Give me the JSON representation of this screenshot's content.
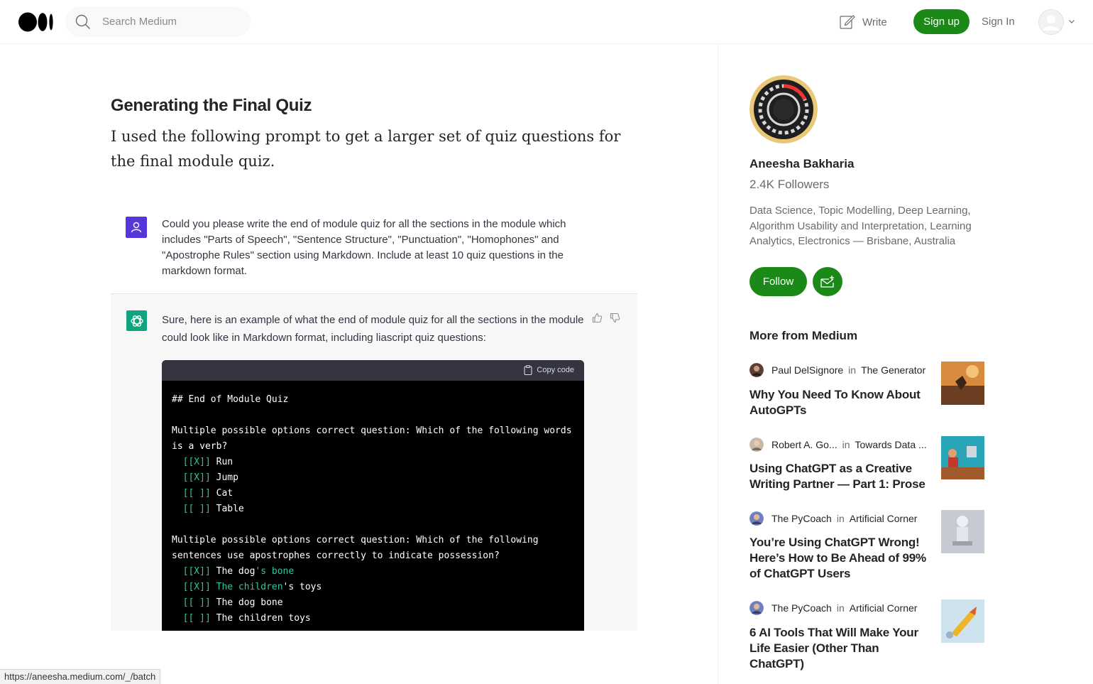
{
  "header": {
    "search_placeholder": "Search Medium",
    "write_label": "Write",
    "signup_label": "Sign up",
    "signin_label": "Sign In"
  },
  "article": {
    "heading": "Generating the Final Quiz",
    "paragraph": "I used the following prompt to get a larger set of quiz questions for the final module quiz."
  },
  "chat": {
    "user_prompt": "Could you please write the end of module quiz for all the sections in the module which includes \"Parts of Speech\",  \"Sentence Structure\",  \"Punctuation\", \"Homophones\" and \"Apostrophe Rules\" section using Markdown. Include at least 10 quiz questions in the markdown format.",
    "ai_reply": "Sure, here is an example of what the end of module quiz for all the sections in the module could look like in Markdown format, including liascript quiz questions:",
    "copy_label": "Copy code",
    "code_lines": {
      "l1": "## End of Module Quiz",
      "l2": "Multiple possible options correct question: Which of the following words",
      "l3": "is a verb?",
      "l4_box": "[[X]]",
      "l4_text": " Run",
      "l5_box": "[[X]]",
      "l5_text": " Jump",
      "l6_box": "[[ ]]",
      "l6_text": " Cat",
      "l7_box": "[[ ]]",
      "l7_text": " Table",
      "l8": "Multiple possible options correct question: Which of the following",
      "l9": "sentences use apostrophes correctly to indicate possession?",
      "l10_box": "[[X]]",
      "l10_a": " The dog",
      "l10_b": "'s bone",
      "l11_box": "[[X]]",
      "l11_a": " The children",
      "l11_b": "'s toys",
      "l12_box": "[[ ]]",
      "l12_text": " The dog bone",
      "l13_box": "[[ ]]",
      "l13_text": " The children toys"
    }
  },
  "author": {
    "name": "Aneesha Bakharia",
    "followers": "2.4K Followers",
    "bio": "Data Science, Topic Modelling, Deep Learning, Algorithm Usability and Interpretation, Learning Analytics, Electronics — Brisbane, Australia",
    "follow_label": "Follow"
  },
  "more_from_medium": {
    "heading": "More from Medium",
    "in_label": "in",
    "items": [
      {
        "author": "Paul DelSignore",
        "publication": "The Generator",
        "title": "Why You Need To Know About AutoGPTs"
      },
      {
        "author": "Robert A. Go...",
        "publication": "Towards Data ...",
        "title": "Using ChatGPT as a Creative Writing Partner — Part 1: Prose"
      },
      {
        "author": "The PyCoach",
        "publication": "Artificial Corner",
        "title": "You’re Using ChatGPT Wrong! Here’s How to Be Ahead of 99% of ChatGPT Users"
      },
      {
        "author": "The PyCoach",
        "publication": "Artificial Corner",
        "title": "6 AI Tools That Will Make Your Life Easier (Other Than ChatGPT)"
      }
    ]
  },
  "status_url": "https://aneesha.medium.com/_/batch",
  "colors": {
    "brand_green": "#1a8917",
    "chatgpt_green": "#10a37f",
    "user_purple": "#5436da"
  }
}
